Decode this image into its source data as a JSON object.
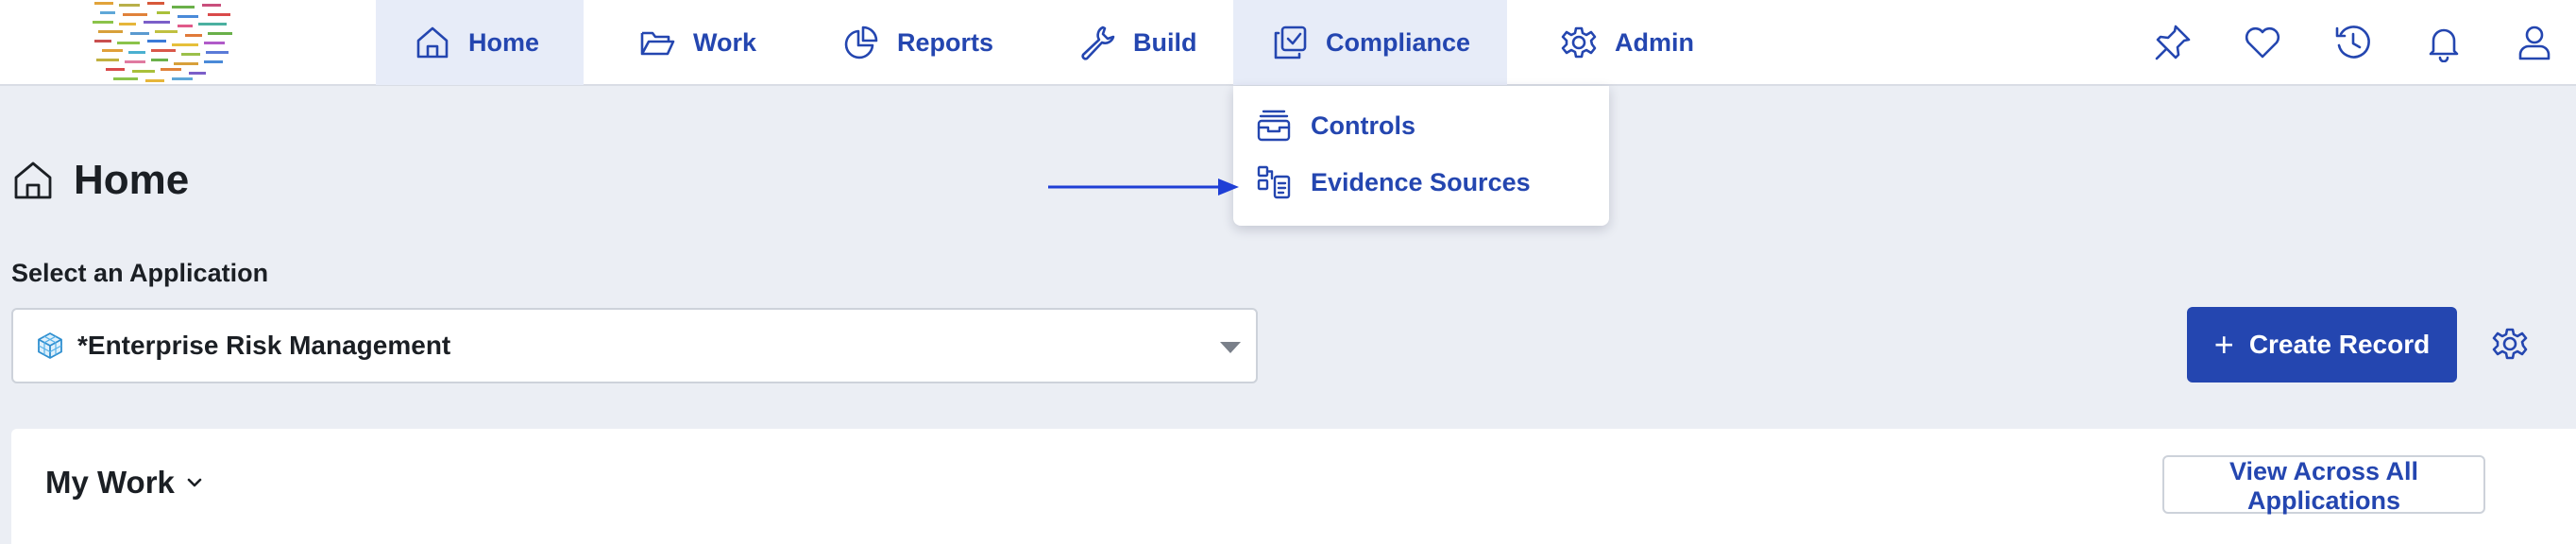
{
  "nav": {
    "home": "Home",
    "work": "Work",
    "reports": "Reports",
    "build": "Build",
    "compliance": "Compliance",
    "admin": "Admin",
    "active": "Home"
  },
  "utility_icons": [
    "pin-icon",
    "heart-icon",
    "history-icon",
    "bell-icon",
    "user-icon"
  ],
  "compliance_menu": {
    "items": [
      {
        "label": "Controls",
        "icon": "archive-icon"
      },
      {
        "label": "Evidence Sources",
        "icon": "flowchart-icon"
      }
    ]
  },
  "page": {
    "title": "Home",
    "select_label": "Select an Application",
    "selected_application": "*Enterprise Risk Management",
    "create_button": "Create Record"
  },
  "my_work": {
    "title": "My Work",
    "view_all_button": "View Across All Applications"
  },
  "colors": {
    "accent": "#2446b0",
    "page_background": "#ebeef4",
    "active_nav_background": "#e7ecf8",
    "annotation_arrow": "#1f3fd6"
  }
}
